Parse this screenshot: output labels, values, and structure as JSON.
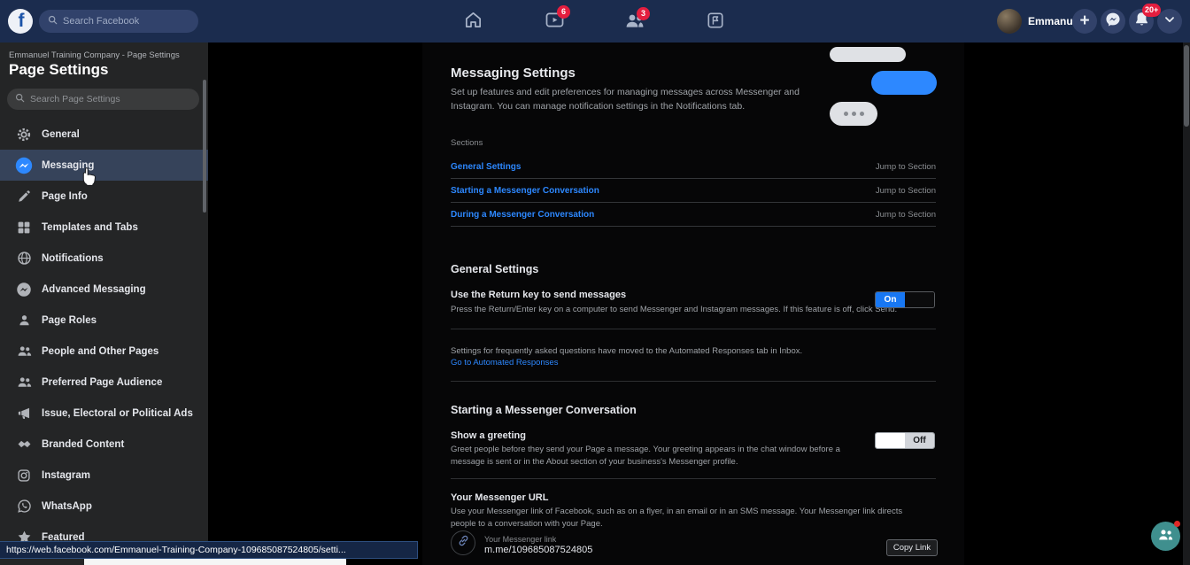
{
  "topbar": {
    "search_placeholder": "Search Facebook",
    "profile_name": "Emmanuel",
    "badges": {
      "watch": "6",
      "groups": "3",
      "notifications": "20+"
    }
  },
  "sidebar": {
    "breadcrumb": "Emmanuel Training Company - Page Settings",
    "title": "Page Settings",
    "search_placeholder": "Search Page Settings",
    "items": [
      {
        "label": "General",
        "icon": "gear-icon",
        "selected": false
      },
      {
        "label": "Messaging",
        "icon": "messenger-icon",
        "selected": true
      },
      {
        "label": "Page Info",
        "icon": "pencil-icon",
        "selected": false
      },
      {
        "label": "Templates and Tabs",
        "icon": "grid-icon",
        "selected": false
      },
      {
        "label": "Notifications",
        "icon": "globe-icon",
        "selected": false
      },
      {
        "label": "Advanced Messaging",
        "icon": "messenger-gray-icon",
        "selected": false
      },
      {
        "label": "Page Roles",
        "icon": "person-icon",
        "selected": false
      },
      {
        "label": "People and Other Pages",
        "icon": "people-icon",
        "selected": false
      },
      {
        "label": "Preferred Page Audience",
        "icon": "people-icon",
        "selected": false
      },
      {
        "label": "Issue, Electoral or Political Ads",
        "icon": "megaphone-icon",
        "selected": false
      },
      {
        "label": "Branded Content",
        "icon": "handshake-icon",
        "selected": false
      },
      {
        "label": "Instagram",
        "icon": "instagram-icon",
        "selected": false
      },
      {
        "label": "WhatsApp",
        "icon": "whatsapp-icon",
        "selected": false
      },
      {
        "label": "Featured",
        "icon": "star-icon",
        "selected": false
      }
    ]
  },
  "main": {
    "title": "Messaging Settings",
    "description": "Set up features and edit preferences for managing messages across Messenger and Instagram. You can manage notification settings in the Notifications tab.",
    "sections_label": "Sections",
    "jump_label": "Jump to Section",
    "section_links": [
      "General Settings",
      "Starting a Messenger Conversation",
      "During a Messenger Conversation"
    ],
    "general": {
      "heading": "General Settings",
      "return_key_title": "Use the Return key to send messages",
      "return_key_desc": "Press the Return/Enter key on a computer to send Messenger and Instagram messages. If this feature is off, click Send.",
      "return_key_state": "On",
      "faq_note": "Settings for frequently asked questions have moved to the Automated Responses tab in Inbox.",
      "faq_link": "Go to Automated Responses"
    },
    "starting": {
      "heading": "Starting a Messenger Conversation",
      "greeting_title": "Show a greeting",
      "greeting_desc": "Greet people before they send your Page a message. Your greeting appears in the chat window before a message is sent or in the About section of your business's Messenger profile.",
      "greeting_state": "Off",
      "url_title": "Your Messenger URL",
      "url_desc": "Use your Messenger link of Facebook, such as on a flyer, in an email or in an SMS message. Your Messenger link directs people to a conversation with your Page.",
      "link_label": "Your Messenger link",
      "link_value": "m.me/109685087524805",
      "copy_button": "Copy Link"
    }
  },
  "toggle": {
    "on": "On",
    "off": "Off"
  },
  "statusbar": {
    "url": "https://web.facebook.com/Emmanuel-Training-Company-109685087524805/setti..."
  },
  "colors": {
    "accent": "#1877f2",
    "link_blue": "#2d88ff",
    "badge_red": "#e41e3f",
    "topbar_navy": "#1b2c4e",
    "widget_teal": "#3f8f8e"
  }
}
